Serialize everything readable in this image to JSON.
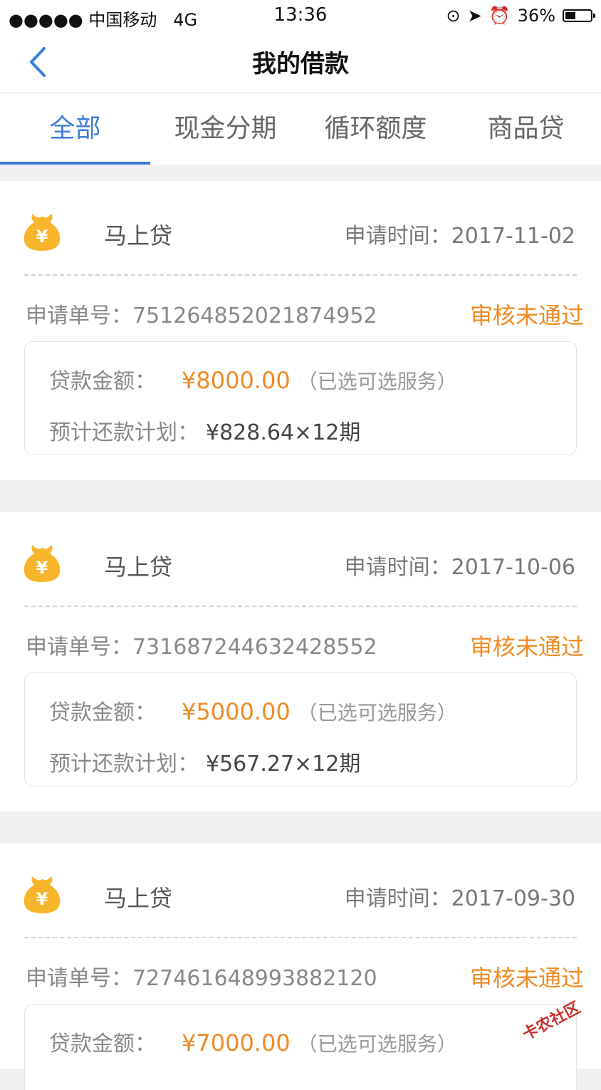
{
  "status_bar": {
    "carrier": "●●●●● 中国移动",
    "network": "4G",
    "time": "13:36",
    "battery": "36%"
  },
  "header": {
    "title": "我的借款"
  },
  "tabs": [
    {
      "label": "全部",
      "active": true
    },
    {
      "label": "现金分期",
      "active": false
    },
    {
      "label": "循环额度",
      "active": false
    },
    {
      "label": "商品贷",
      "active": false
    }
  ],
  "loans": [
    {
      "product": "马上贷",
      "apply_time_label": "申请时间：",
      "apply_time": "2017-11-02",
      "order_label": "申请单号：",
      "order_no": "751264852021874952",
      "status": "审核未通过",
      "amount_label": "贷款金额：",
      "amount": "¥8000.00",
      "amount_note": "（已选可选服务）",
      "plan_label": "预计还款计划：",
      "plan": "¥828.64×12期"
    },
    {
      "product": "马上贷",
      "apply_time_label": "申请时间：",
      "apply_time": "2017-10-06",
      "order_label": "申请单号：",
      "order_no": "731687244632428552",
      "status": "审核未通过",
      "amount_label": "贷款金额：",
      "amount": "¥5000.00",
      "amount_note": "（已选可选服务）",
      "plan_label": "预计还款计划：",
      "plan": "¥567.27×12期"
    },
    {
      "product": "马上贷",
      "apply_time_label": "申请时间：",
      "apply_time": "2017-09-30",
      "order_label": "申请单号：",
      "order_no": "727461648993882120",
      "status": "审核未通过",
      "amount_label": "贷款金额：",
      "amount": "¥7000.00",
      "amount_note": "（已选可选服务）",
      "plan_label": "",
      "plan": ""
    }
  ],
  "watermark": "卡农社区",
  "colors": {
    "accent": "#3b7ddb",
    "status": "#f08a24",
    "icon": "#f7b52c"
  }
}
